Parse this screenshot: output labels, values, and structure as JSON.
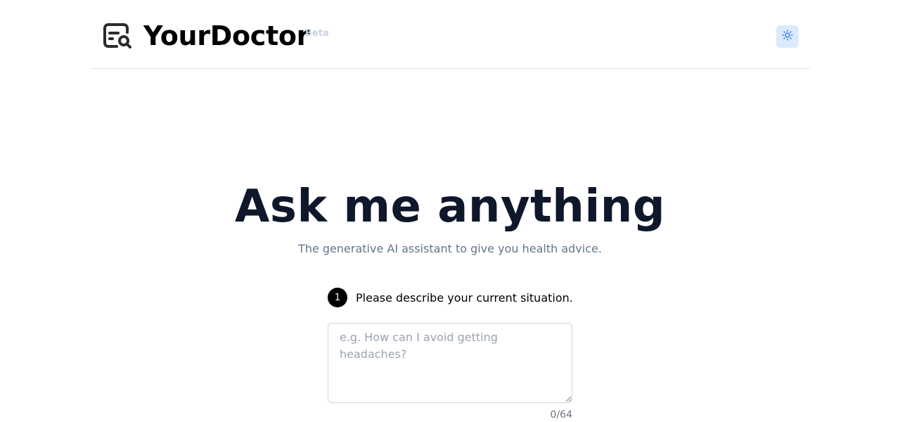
{
  "header": {
    "brand": "YourDoctor",
    "badge": "Beta",
    "logo_icon": "search-document-icon",
    "theme_toggle_icon": "sun-icon"
  },
  "hero": {
    "title": "Ask me anything",
    "subtitle": "The generative AI assistant to give you health advice."
  },
  "form": {
    "step_number": "1",
    "step_label": "Please describe your current situation.",
    "situation_placeholder": "e.g. How can I avoid getting headaches?",
    "situation_value": "",
    "char_counter": "0/64"
  },
  "colors": {
    "accent_bg": "#dbeafe",
    "accent": "#3b82f6",
    "title": "#0f172a",
    "subtitle": "#64748b",
    "badge": "#c7d2e0"
  }
}
